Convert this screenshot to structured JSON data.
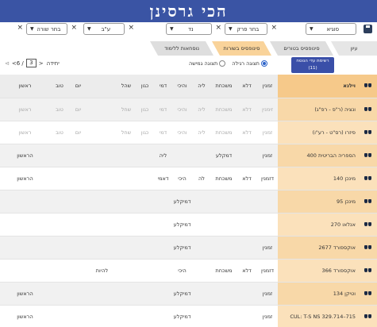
{
  "app": {
    "title": "הכי גרסינן"
  },
  "toolbar": {
    "sugya_label": "סוגיא",
    "perek_label": "בחר פרק",
    "daf_label": "נד",
    "amud_label": "ע\"ב",
    "line_label": "בחר שורה"
  },
  "tabs": [
    {
      "label": "עיון"
    },
    {
      "label": "סינופסיס בטורים"
    },
    {
      "label": "סינופסיס בשורות"
    },
    {
      "label": "נוסחאות ללימוד"
    }
  ],
  "controls": {
    "add_button_label": "רשימת עדי הנוסח (11)",
    "radio_regular": "תצוגה רגילה",
    "radio_flexible": "תצוגה גמישה",
    "regular_selected": true,
    "page_label": "יחידה",
    "page_current": "3",
    "page_total": "6 /"
  },
  "table": {
    "header": {
      "name": "וילנא",
      "cols": [
        "זמנין",
        "דלא",
        "משכחת",
        "ליה",
        "והיכי",
        "דמי",
        "כגון",
        "שהל",
        "",
        "יום",
        "טוב",
        "ראשון"
      ]
    },
    "rows": [
      {
        "name": "ונציה (ר\"פ - רפ\"ג)",
        "dim": true,
        "cells": [
          "זימנין",
          "דלא",
          "משכחת",
          "ליה",
          "והיכי",
          "דמי",
          "כגון",
          "שחל",
          "",
          "יום",
          "טוב",
          "ראשון"
        ]
      },
      {
        "name": "פיזרו (רס\"ט - רע\"ו)",
        "dim": true,
        "cells": [
          "זמנין",
          "דלא",
          "משכחת",
          "ליה",
          "והיכי",
          "דמי",
          "כגון",
          "שחל",
          "",
          "יום",
          "טוב",
          "ראשון"
        ]
      },
      {
        "name": "הספריה הבריטית 400",
        "dim": false,
        "cells": [
          "זמנין",
          "",
          "דמקלע",
          "",
          "",
          "ליה",
          "",
          "",
          "",
          "",
          "",
          "הראשון"
        ]
      },
      {
        "name": "מינכן 140",
        "dim": false,
        "cells": [
          "דזמנין",
          "דלא",
          "משכחת",
          "לה",
          "היכי",
          "דאמי",
          "",
          "",
          "",
          "",
          "",
          "הראשון"
        ]
      },
      {
        "name": "מינכן 95",
        "dim": false,
        "cells": [
          "",
          "",
          "",
          "",
          "דמיקלע",
          "",
          "",
          "",
          "",
          "",
          "",
          ""
        ]
      },
      {
        "name": "אנלאו 270",
        "dim": false,
        "cells": [
          "",
          "",
          "",
          "",
          "דמיקלע",
          "",
          "",
          "",
          "",
          "",
          "",
          ""
        ]
      },
      {
        "name": "אוקספורד 2677",
        "dim": false,
        "cells": [
          "זמנין",
          "",
          "",
          "",
          "דמיקלע",
          "",
          "",
          "",
          "",
          "",
          "",
          ""
        ]
      },
      {
        "name": "אוקספורד 366",
        "dim": false,
        "cells": [
          "דזמנין",
          "דלא",
          "משכחת",
          "",
          "היכי",
          "",
          "",
          "",
          "להיות",
          "",
          "",
          ""
        ]
      },
      {
        "name": "וטיקן 134",
        "dim": false,
        "cells": [
          "זמנין",
          "",
          "",
          "",
          "דמיקלע",
          "",
          "",
          "",
          "",
          "",
          "",
          "הראשון"
        ]
      },
      {
        "name": "CUL: T-S NS 329.714–715",
        "dim": false,
        "cells": [
          "זמנין",
          "",
          "",
          "",
          "דמיקלע",
          "",
          "",
          "",
          "",
          "",
          "",
          "הראשון"
        ]
      }
    ]
  }
}
